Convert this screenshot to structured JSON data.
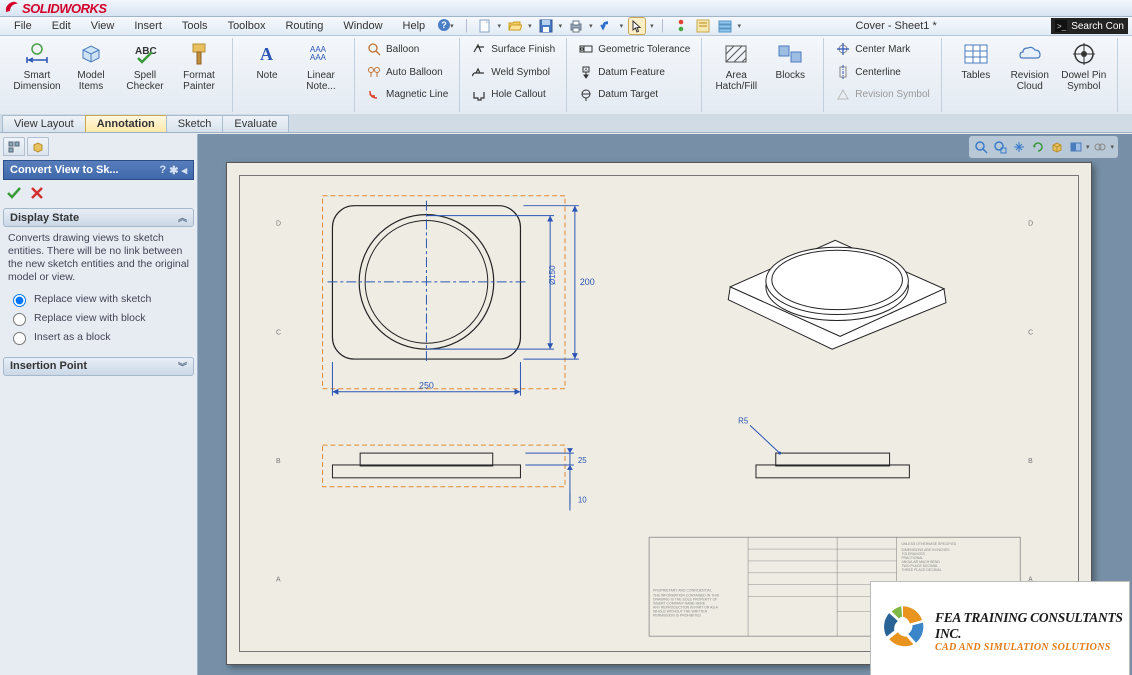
{
  "app": {
    "brand": "SOLIDWORKS",
    "doc_title": "Cover - Sheet1 *",
    "search_placeholder": "Search Con"
  },
  "menu": [
    "File",
    "Edit",
    "View",
    "Insert",
    "Tools",
    "Toolbox",
    "Routing",
    "Window",
    "Help"
  ],
  "ribbon": {
    "g1": [
      {
        "l": "Smart Dimension"
      },
      {
        "l": "Model Items"
      },
      {
        "l": "Spell Checker"
      },
      {
        "l": "Format Painter"
      }
    ],
    "g2": [
      {
        "l": "Note"
      },
      {
        "l": "Linear Note..."
      }
    ],
    "g3": [
      "Balloon",
      "Auto Balloon",
      "Magnetic Line"
    ],
    "g4": [
      "Surface Finish",
      "Weld Symbol",
      "Hole Callout"
    ],
    "g5": [
      "Geometric Tolerance",
      "Datum Feature",
      "Datum Target"
    ],
    "g6": [
      {
        "l": "Area Hatch/Fill"
      },
      {
        "l": "Blocks"
      }
    ],
    "g7": [
      "Center Mark",
      "Centerline",
      "Revision Symbol"
    ],
    "g8": [
      {
        "l": "Tables"
      },
      {
        "l": "Revision Cloud"
      },
      {
        "l": "Dowel Pin Symbol"
      }
    ]
  },
  "tabs": [
    "View Layout",
    "Annotation",
    "Sketch",
    "Evaluate"
  ],
  "active_tab": "Annotation",
  "pm": {
    "title": "Convert View to Sk...",
    "sec1_title": "Display State",
    "sec1_desc": "Converts drawing views to sketch entities. There will be no link between the new sketch entities and the original model or view.",
    "opts": [
      "Replace view with sketch",
      "Replace view with block",
      "Insert as a block"
    ],
    "sec2_title": "Insertion Point"
  },
  "dims": {
    "width": "250",
    "dia": "Ø150",
    "h_outer": "200",
    "step": "25",
    "thk": "10",
    "rad": "R5"
  },
  "watermark": {
    "line1": "FEA TRAINING CONSULTANTS INC.",
    "line2": "CAD AND SIMULATION SOLUTIONS"
  }
}
